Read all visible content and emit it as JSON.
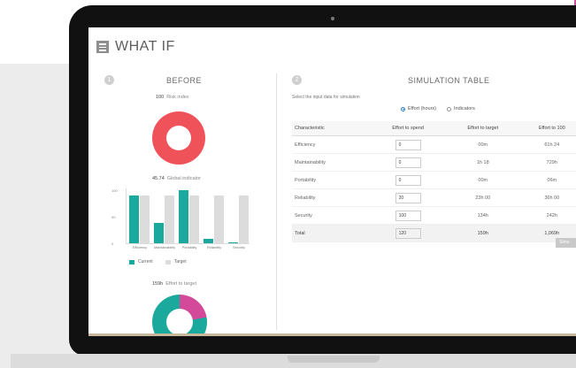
{
  "page": {
    "title": "WHAT IF"
  },
  "before": {
    "badge": "1",
    "title": "BEFORE",
    "risk": {
      "value": "100",
      "label": "Risk index"
    },
    "global": {
      "value": "45.74",
      "label": "Global indicator"
    },
    "effort": {
      "value": "159h",
      "label": "Effort to target"
    },
    "legend": {
      "current": "Current",
      "target": "Target"
    }
  },
  "simulation": {
    "badge": "2",
    "title": "SIMULATION TABLE",
    "hint": "Select the input data for simulation",
    "radio": {
      "effort": "Effort (hours)",
      "indicators": "Indicators"
    },
    "headers": [
      "Characteristic",
      "Effort to spend",
      "Effort to target",
      "Effort to 100"
    ],
    "rows": [
      {
        "name": "Efficiency",
        "spend": "0",
        "target": "00m",
        "to100": "61h 24"
      },
      {
        "name": "Maintainability",
        "spend": "0",
        "target": "1h 18",
        "to100": "729h"
      },
      {
        "name": "Portability",
        "spend": "0",
        "target": "00m",
        "to100": "06m"
      },
      {
        "name": "Reliability",
        "spend": "20",
        "target": "23h 00",
        "to100": "36h 00"
      },
      {
        "name": "Security",
        "spend": "100",
        "target": "134h",
        "to100": "242h"
      },
      {
        "name": "Total",
        "spend": "120",
        "target": "159h",
        "to100": "1,069h"
      }
    ],
    "button": "Simu"
  },
  "chart_data": {
    "type": "bar",
    "categories": [
      "Efficiency",
      "Maintainability",
      "Portability",
      "Reliability",
      "Security"
    ],
    "series": [
      {
        "name": "Current",
        "values": [
          90,
          38,
          100,
          8,
          2
        ]
      },
      {
        "name": "Target",
        "values": [
          90,
          90,
          90,
          90,
          90
        ]
      }
    ],
    "yticks": [
      "100",
      "50",
      "0"
    ],
    "ylim": [
      0,
      100
    ],
    "colors": {
      "Current": "#1aa99c",
      "Target": "#dcdcdc"
    }
  },
  "effort_donut": {
    "values": [
      22,
      78
    ],
    "colors": [
      "#d44a9a",
      "#1aa99c"
    ]
  },
  "colors": {
    "accent": "#1aa99c",
    "risk": "#f0525a",
    "highlight": "#d44a9a"
  }
}
